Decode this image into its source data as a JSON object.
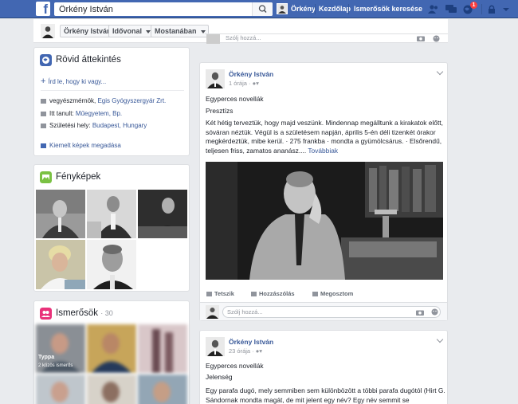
{
  "topbar": {
    "search_value": "Örkény István",
    "profile_name": "Örkény",
    "home": "Kezdőlap",
    "find_friends": "Ismerősök keresése",
    "notifications_count": "1"
  },
  "profile_bar": {
    "name": "Örkény István",
    "timeline": "Idővonal",
    "recent": "Mostanában"
  },
  "intro": {
    "title": "Rövid áttekintés",
    "add_bio": "Írd le, hogy ki vagy...",
    "work_prefix": "vegyészmérnök, ",
    "work_link": "Egis Gyógyszergyár Zrt.",
    "study_prefix": "Itt tanult: ",
    "study_link": "Műegyetem, Bp.",
    "born_prefix": "Születési hely: ",
    "born_link": "Budapest, Hungary",
    "featured": "Kiemelt képek megadása"
  },
  "photos": {
    "title": "Fényképek"
  },
  "friends": {
    "title": "Ismerősök",
    "count": "· 30",
    "friend1_name": "Typpa",
    "friend1_mutual": "2 közös ismerős"
  },
  "composer_top": {
    "placeholder": "Szólj hozzá..."
  },
  "post1": {
    "author": "Örkény István",
    "time": "1 órája · ",
    "line1": "Egyperces novellák",
    "line2": "Presztízs",
    "body": "Két hétig terveztük, hogy majd veszünk. Mindennap megálltunk a kirakatok előtt, sóváran néztük. Végül is a születésem napján, április 5-én déli tizenkét órakor megkérdeztük, mibe kerül. · 275 frankba · mondta a gyümölcsárus. · Elsőrendű, teljesen friss, zamatos ananász.... ",
    "more": "Továbbiak",
    "like": "Tetszik",
    "comment": "Hozzászólás",
    "share": "Megosztom",
    "comment_placeholder": "Szólj hozzá..."
  },
  "post2": {
    "author": "Örkény István",
    "time": "23 órája · ",
    "line1": "Egyperces novellák",
    "line2": "Jelenség",
    "body": "Egy parafa dugó, mely semmiben sem különbözött a többi parafa dugótól (Hirt G. Sándornak mondta magát, de mit jelent egy név? Egy név semmit se"
  },
  "colors": {
    "brand": "#4267b2",
    "link": "#385898",
    "background": "#e9ebee"
  }
}
